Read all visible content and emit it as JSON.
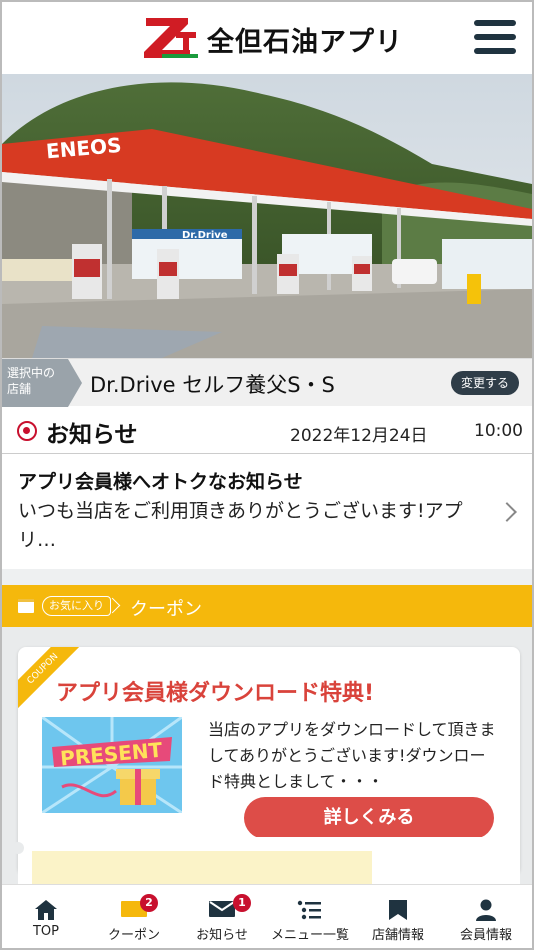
{
  "header": {
    "logo_text": "Z",
    "app_title": "全但石油アプリ"
  },
  "hero": {
    "brand_sign": "ENEOS",
    "shop_sign": "Dr.Drive"
  },
  "store": {
    "tag_label_1": "選択中の",
    "tag_label_2": "店舗",
    "name": "Dr.Drive セルフ養父S・S",
    "change_label": "変更する"
  },
  "news": {
    "title": "お知らせ",
    "date": "2022年12月24日",
    "time": "10:00",
    "item_title": "アプリ会員様へオトクなお知らせ",
    "item_body": "いつも当店をご利用頂きありがとうございます!アプリ…"
  },
  "coupon_section": {
    "fav_tag": "お気に入り",
    "label": "クーポン"
  },
  "coupon_card": {
    "ribbon": "COUPON",
    "title": "アプリ会員様ダウンロード特典!",
    "present_word": "PRESENT",
    "text": "当店のアプリをダウンロードして頂きましてありがとうございます!ダウンロード特典としまして・・・",
    "detail_label": "詳しくみる"
  },
  "tabbar": {
    "items": [
      {
        "label": "TOP",
        "icon": "home-icon"
      },
      {
        "label": "クーポン",
        "icon": "coupon-icon",
        "badge": "2"
      },
      {
        "label": "お知らせ",
        "icon": "mail-icon",
        "badge": "1"
      },
      {
        "label": "メニュー一覧",
        "icon": "list-icon"
      },
      {
        "label": "店舗情報",
        "icon": "bookmark-icon"
      },
      {
        "label": "会員情報",
        "icon": "person-icon"
      }
    ]
  },
  "colors": {
    "accent_red": "#c8102e",
    "coupon_yellow": "#f5b80c",
    "button_red": "#dd4d48",
    "dark_navy": "#1f3340"
  }
}
